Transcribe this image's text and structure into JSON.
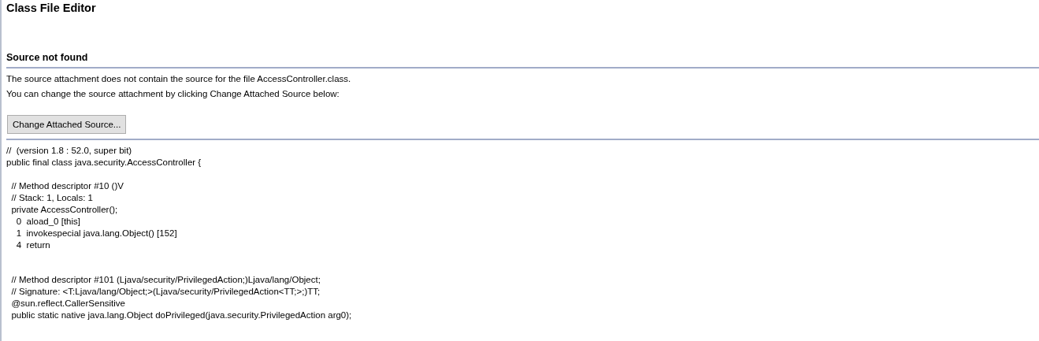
{
  "editor": {
    "title": "Class File Editor"
  },
  "notice": {
    "heading": "Source not found",
    "lines": [
      "The source attachment does not contain the source for the file AccessController.class.",
      "You can change the source attachment by clicking Change Attached Source below:"
    ],
    "button": "Change Attached Source..."
  },
  "code_blocks": [
    {
      "lines": [
        "//  (version 1.8 : 52.0, super bit)",
        "public final class java.security.AccessController {"
      ]
    },
    {
      "lines": [
        "  // Method descriptor #10 ()V",
        "  // Stack: 1, Locals: 1",
        "  private AccessController();",
        "    0  aload_0 [this]",
        "    1  invokespecial java.lang.Object() [152]",
        "    4  return"
      ]
    },
    {
      "lines": [
        "  // Method descriptor #101 (Ljava/security/PrivilegedAction;)Ljava/lang/Object;",
        "  // Signature: <T:Ljava/lang/Object;>(Ljava/security/PrivilegedAction<TT;>;)TT;",
        "  @sun.reflect.CallerSensitive",
        "  public static native java.lang.Object doPrivileged(java.security.PrivilegedAction arg0);"
      ]
    }
  ]
}
